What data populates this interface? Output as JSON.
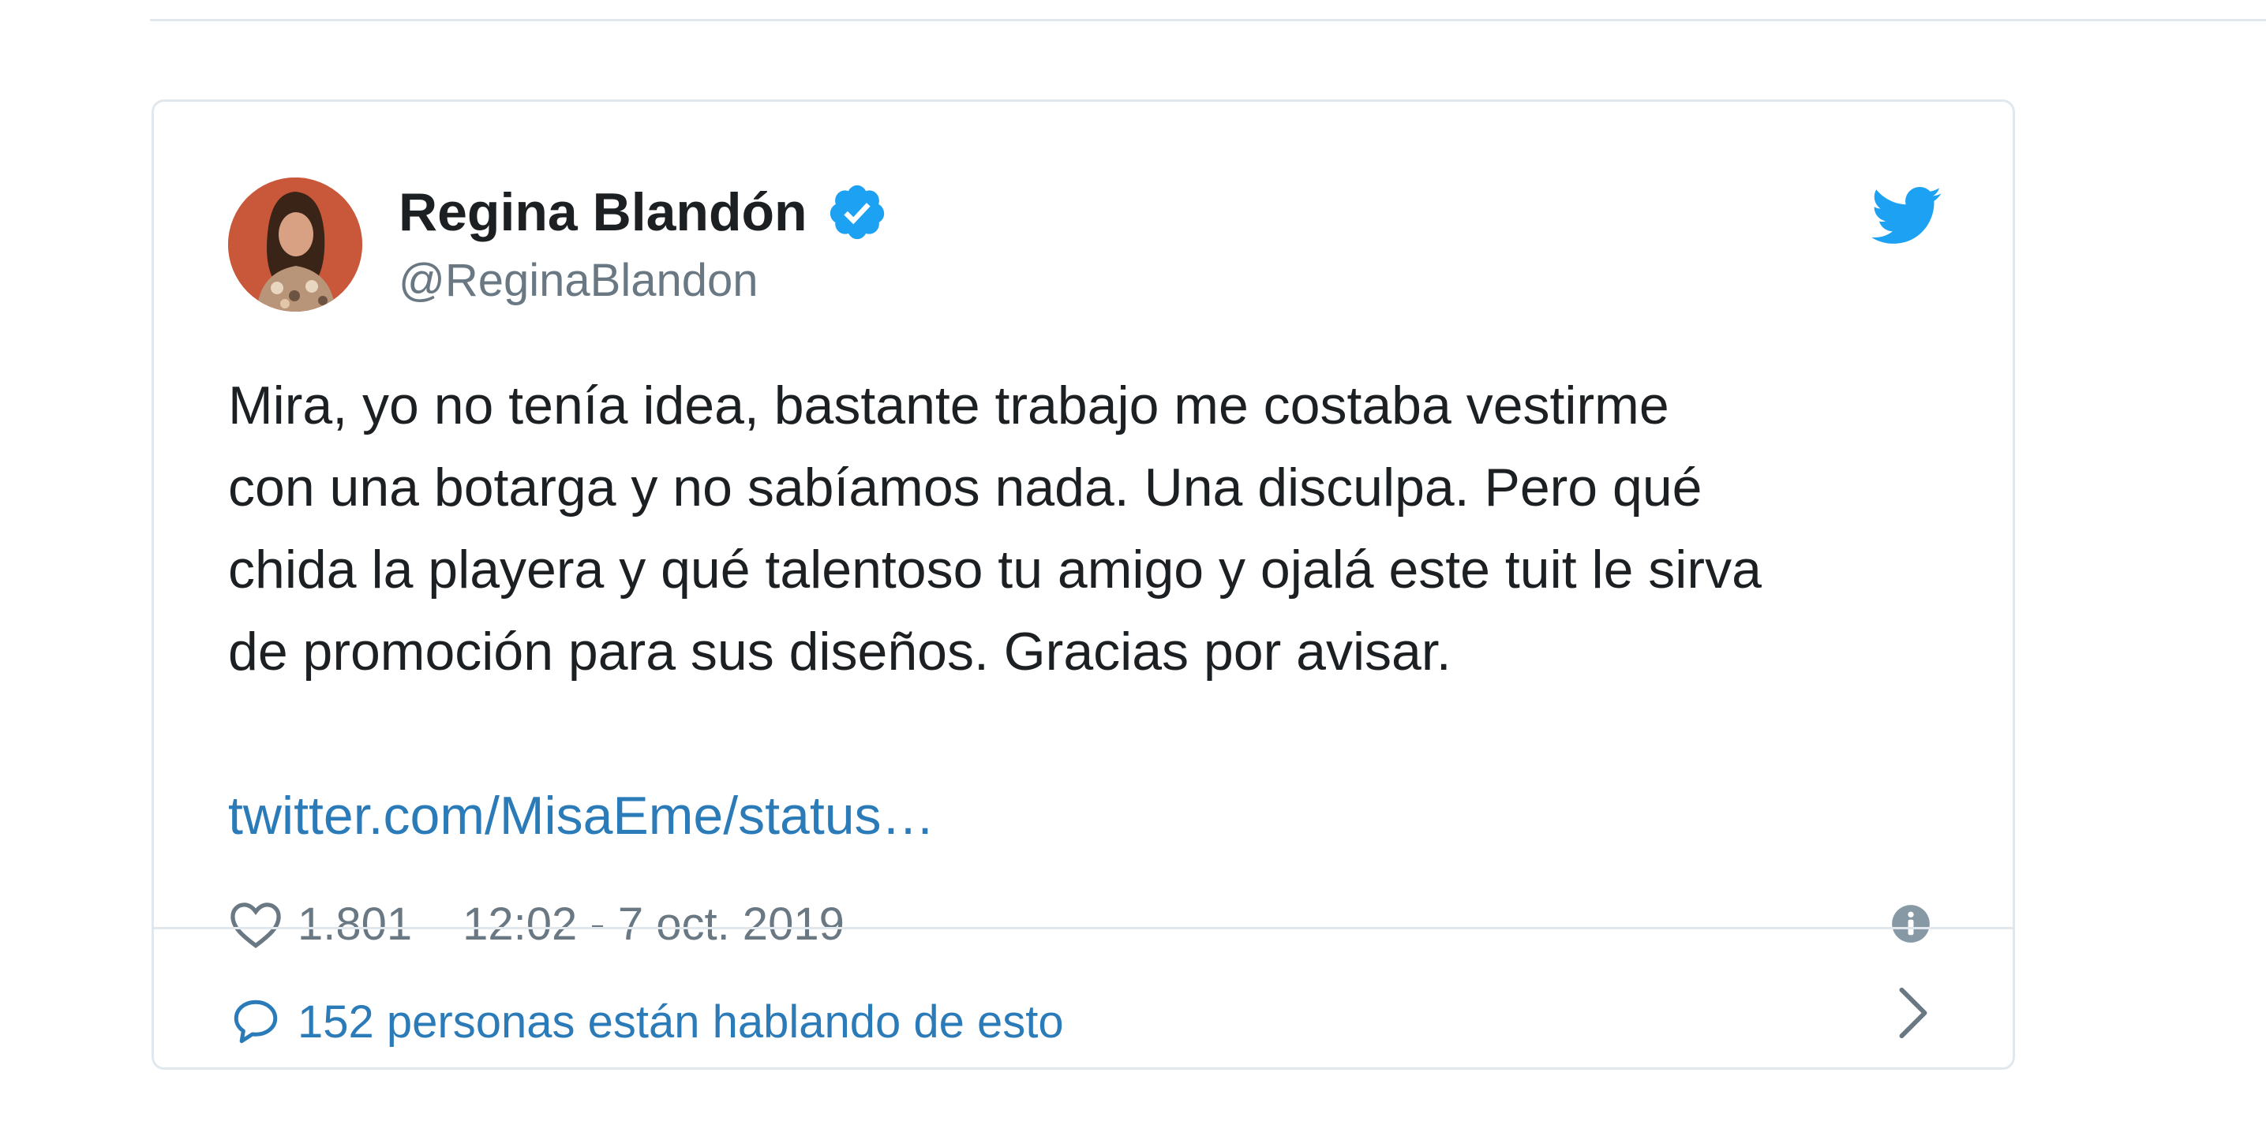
{
  "tweet": {
    "author_name": "Regina Blandón",
    "handle": "@ReginaBlandon",
    "text": "Mira, yo no tenía idea, bastante trabajo me costaba vestirme\ncon una botarga y no sabíamos nada. Una disculpa. Pero qué\nchida la playera y qué talentoso tu amigo y ojalá este tuit le sirva\nde promoción para sus diseños. Gracias por avisar.",
    "link": "twitter.com/MisaEme/status…",
    "likes": "1.801",
    "timestamp": "12:02 - 7 oct. 2019",
    "conversation": "152 personas están hablando de esto"
  },
  "icons": {
    "verified": "verified-badge-icon",
    "brand": "twitter-bird-icon",
    "like": "heart-icon",
    "info": "info-icon",
    "reply": "reply-bubble-icon",
    "chevron": "chevron-right-icon"
  },
  "colors": {
    "brand_blue": "#1da1f2",
    "link_blue": "#2b7bb9",
    "text": "#1c2022",
    "muted": "#697882",
    "border": "#e1e8ed"
  }
}
